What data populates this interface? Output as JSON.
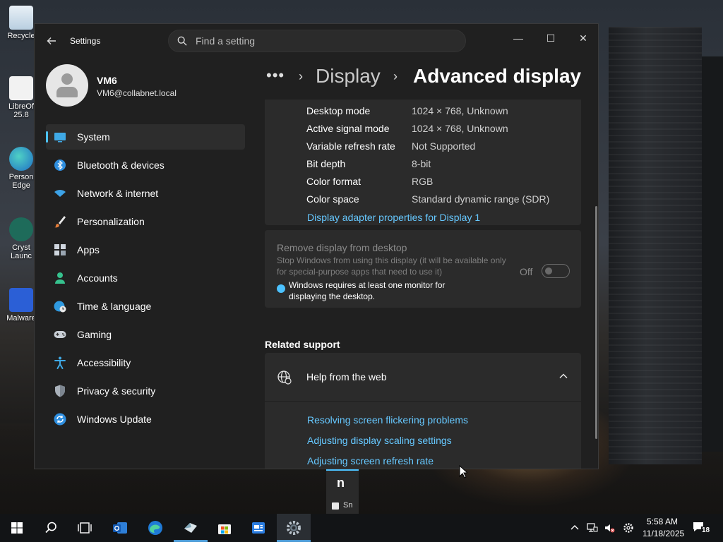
{
  "desktop": {
    "icons": [
      {
        "label": "Recycle"
      },
      {
        "label": "LibreOf 25.8"
      },
      {
        "label": "Person Edge"
      },
      {
        "label": "Cryst Launc"
      },
      {
        "label": "Malware"
      }
    ]
  },
  "window": {
    "app_title": "Settings",
    "search": {
      "placeholder": "Find a setting"
    },
    "controls": {
      "minimize": "—",
      "maximize": "☐",
      "close": "✕"
    }
  },
  "profile": {
    "name": "VM6",
    "email": "VM6@collabnet.local"
  },
  "sidebar": {
    "items": [
      {
        "label": "System",
        "icon": "monitor-icon",
        "active": true
      },
      {
        "label": "Bluetooth & devices",
        "icon": "bluetooth-icon"
      },
      {
        "label": "Network & internet",
        "icon": "wifi-icon"
      },
      {
        "label": "Personalization",
        "icon": "brush-icon"
      },
      {
        "label": "Apps",
        "icon": "apps-icon"
      },
      {
        "label": "Accounts",
        "icon": "person-icon"
      },
      {
        "label": "Time & language",
        "icon": "globe-clock-icon"
      },
      {
        "label": "Gaming",
        "icon": "gamepad-icon"
      },
      {
        "label": "Accessibility",
        "icon": "accessibility-icon"
      },
      {
        "label": "Privacy & security",
        "icon": "shield-icon"
      },
      {
        "label": "Windows Update",
        "icon": "update-icon"
      }
    ]
  },
  "breadcrumb": {
    "more": "•••",
    "sep": "›",
    "parent": "Display",
    "current": "Advanced display"
  },
  "display_info": {
    "rows": [
      {
        "label": "Desktop mode",
        "value": "1024 × 768, Unknown"
      },
      {
        "label": "Active signal mode",
        "value": "1024 × 768, Unknown"
      },
      {
        "label": "Variable refresh rate",
        "value": "Not Supported"
      },
      {
        "label": "Bit depth",
        "value": "8-bit"
      },
      {
        "label": "Color format",
        "value": "RGB"
      },
      {
        "label": "Color space",
        "value": "Standard dynamic range (SDR)"
      }
    ],
    "adapter_link": "Display adapter properties for Display 1"
  },
  "remove_display": {
    "title": "Remove display from desktop",
    "description": "Stop Windows from using this display (it will be available only for special-purpose apps that need to use it)",
    "warning": "Windows requires at least one monitor for displaying the desktop.",
    "toggle_label": "Off",
    "toggle_on": false
  },
  "related_support": {
    "title": "Related support",
    "help_label": "Help from the web",
    "links": [
      "Resolving screen flickering problems",
      "Adjusting display scaling settings",
      "Adjusting screen refresh rate"
    ]
  },
  "snip_popup": {
    "letter": "n",
    "label": "Sn"
  },
  "taskbar": {
    "apps": [
      "start-icon",
      "search-icon",
      "task-view-icon",
      "outlook-icon",
      "edge-icon",
      "crystal-app-icon",
      "store-icon",
      "news-icon",
      "settings-icon"
    ],
    "clock": {
      "time": "5:58 AM",
      "date": "11/18/2025"
    },
    "notifications": "18"
  },
  "colors": {
    "accent": "#4cc2ff",
    "link": "#66c8ff",
    "window_bg": "#202020",
    "card_bg": "#2b2b2b"
  }
}
